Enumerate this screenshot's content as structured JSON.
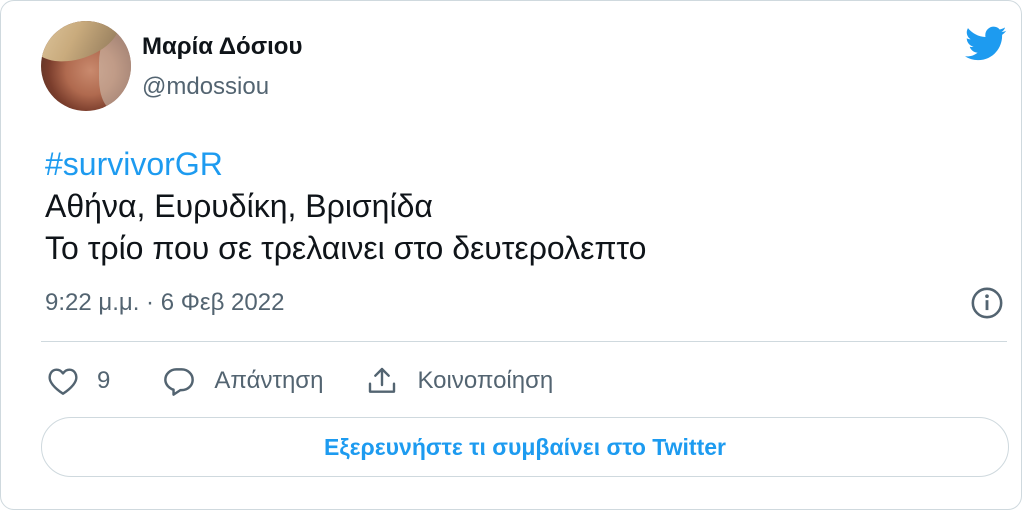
{
  "author": {
    "display_name": "Μαρία Δόσιου",
    "handle": "@mdossiou"
  },
  "tweet": {
    "hashtag": "#survivorGR",
    "line1": "Αθήνα, Ευρυδίκη, Βρισηίδα",
    "line2": "Το τρίο που σε τρελαινει στο δευτερολεπτο",
    "timestamp": "9:22 μ.μ. · 6 Φεβ 2022"
  },
  "actions": {
    "like_count": "9",
    "reply_label": "Απάντηση",
    "share_label": "Κοινοποίηση"
  },
  "explore_button": {
    "label": "Εξερευνήστε τι συμβαίνει στο Twitter"
  },
  "colors": {
    "accent": "#1d9bf0",
    "text_primary": "#0f1419",
    "text_secondary": "#536471",
    "border": "#cfd9de"
  },
  "icons": [
    "twitter-bird-icon",
    "info-icon",
    "heart-icon",
    "reply-bubble-icon",
    "share-icon"
  ]
}
